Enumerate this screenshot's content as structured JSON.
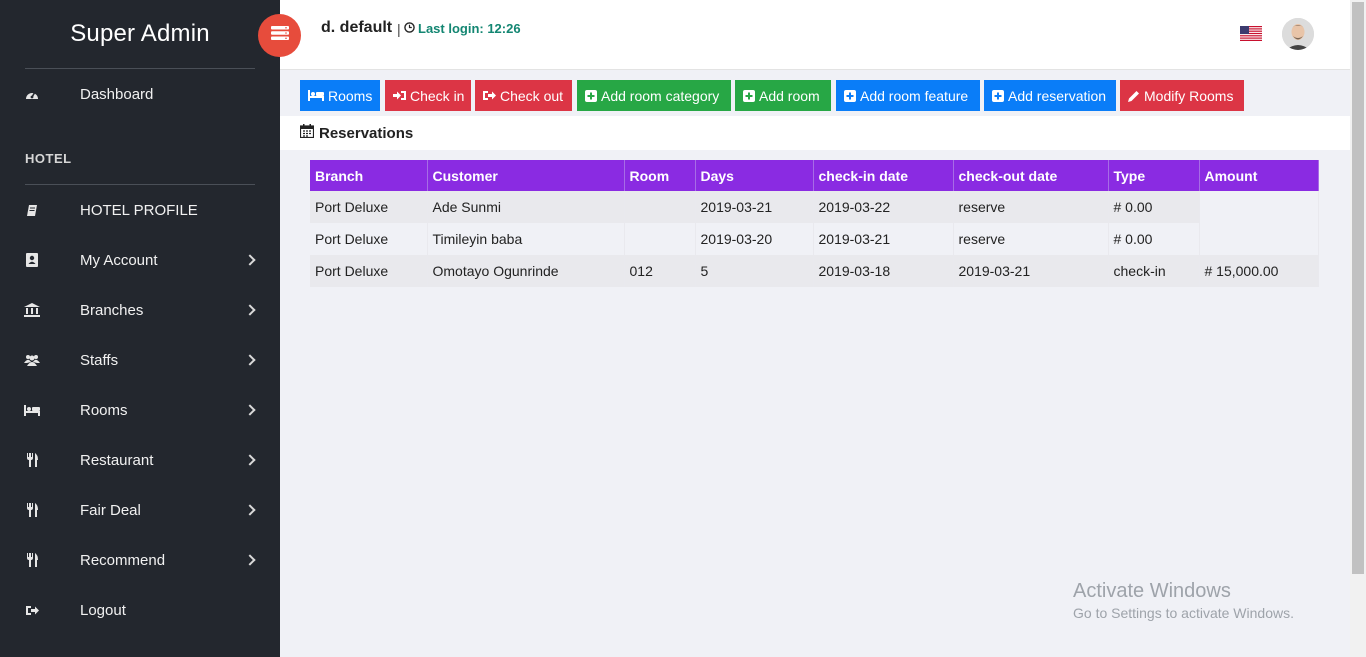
{
  "sidebar": {
    "brand": "Super Admin",
    "section": "HOTEL",
    "items": [
      {
        "label": "Dashboard",
        "icon": "dashboard-icon"
      },
      {
        "label": "HOTEL PROFILE",
        "icon": "book-icon"
      },
      {
        "label": "My Account",
        "icon": "account-icon"
      },
      {
        "label": "Branches",
        "icon": "bank-icon"
      },
      {
        "label": "Staffs",
        "icon": "users-icon"
      },
      {
        "label": "Rooms",
        "icon": "bed-icon"
      },
      {
        "label": "Restaurant",
        "icon": "cutlery-icon"
      },
      {
        "label": "Fair Deal",
        "icon": "cutlery-icon"
      },
      {
        "label": "Recommend",
        "icon": "cutlery-icon"
      },
      {
        "label": "Logout",
        "icon": "logout-icon"
      }
    ]
  },
  "header": {
    "user": "d. default",
    "pipe": "|",
    "last_login": "Last login: 12:26"
  },
  "toolbar": {
    "rooms": "Rooms",
    "check_in": "Check in",
    "check_out": "Check out",
    "add_room_category": "Add room category",
    "add_room": "Add room",
    "add_room_feature": "Add room feature",
    "add_reservation": "Add reservation",
    "modify_rooms": "Modify Rooms"
  },
  "reservations": {
    "title": "Reservations",
    "columns": [
      "Branch",
      "Customer",
      "Room",
      "Days",
      "check-in date",
      "check-out date",
      "Type",
      "Amount"
    ],
    "rows": [
      [
        "Port Deluxe",
        "Ade Sunmi",
        "",
        "2019-03-21",
        "2019-03-22",
        "reserve",
        "# 0.00",
        ""
      ],
      [
        "Port Deluxe",
        "Timileyin baba",
        "",
        "2019-03-20",
        "2019-03-21",
        "reserve",
        "# 0.00",
        ""
      ],
      [
        "Port Deluxe",
        "Omotayo Ogunrinde",
        "012",
        "5",
        "2019-03-18",
        "2019-03-21",
        "check-in",
        "# 15,000.00"
      ]
    ]
  },
  "watermark": {
    "line1": "Activate Windows",
    "line2": "Go to Settings to activate Windows."
  },
  "colors": {
    "sidebar": "#23272e",
    "table_header": "#8a2be2",
    "blue": "#0a7df8",
    "red": "#dc3545",
    "green": "#27a745",
    "toggle": "#e74c3c",
    "last_login": "#138672"
  }
}
